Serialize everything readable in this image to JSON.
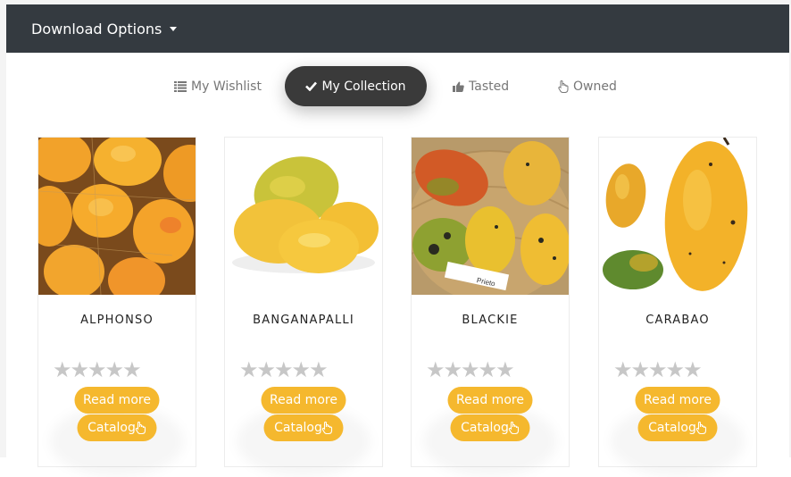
{
  "toolbar": {
    "download_label": "Download Options"
  },
  "tabs": [
    {
      "label": "My Wishlist",
      "icon": "list-icon",
      "active": false
    },
    {
      "label": "My Collection",
      "icon": "check-icon",
      "active": true
    },
    {
      "label": "Tasted",
      "icon": "thumbs-up-icon",
      "active": false
    },
    {
      "label": "Owned",
      "icon": "hand-pointer-icon",
      "active": false
    }
  ],
  "cards": [
    {
      "title": "ALPHONSO",
      "rating": 0,
      "stars": "★★★★★",
      "read_more": "Read more",
      "catalog": "Catalog"
    },
    {
      "title": "BANGANAPALLI",
      "rating": 0,
      "stars": "★★★★★",
      "read_more": "Read more",
      "catalog": "Catalog"
    },
    {
      "title": "BLACKIE",
      "rating": 0,
      "stars": "★★★★★",
      "read_more": "Read more",
      "catalog": "Catalog"
    },
    {
      "title": "CARABAO",
      "rating": 0,
      "stars": "★★★★★",
      "read_more": "Read more",
      "catalog": "Catalog"
    }
  ],
  "colors": {
    "topbar": "#343a40",
    "active_tab": "#3a3a3a",
    "button": "#f5b82e",
    "star_empty": "#c7c7c7"
  }
}
